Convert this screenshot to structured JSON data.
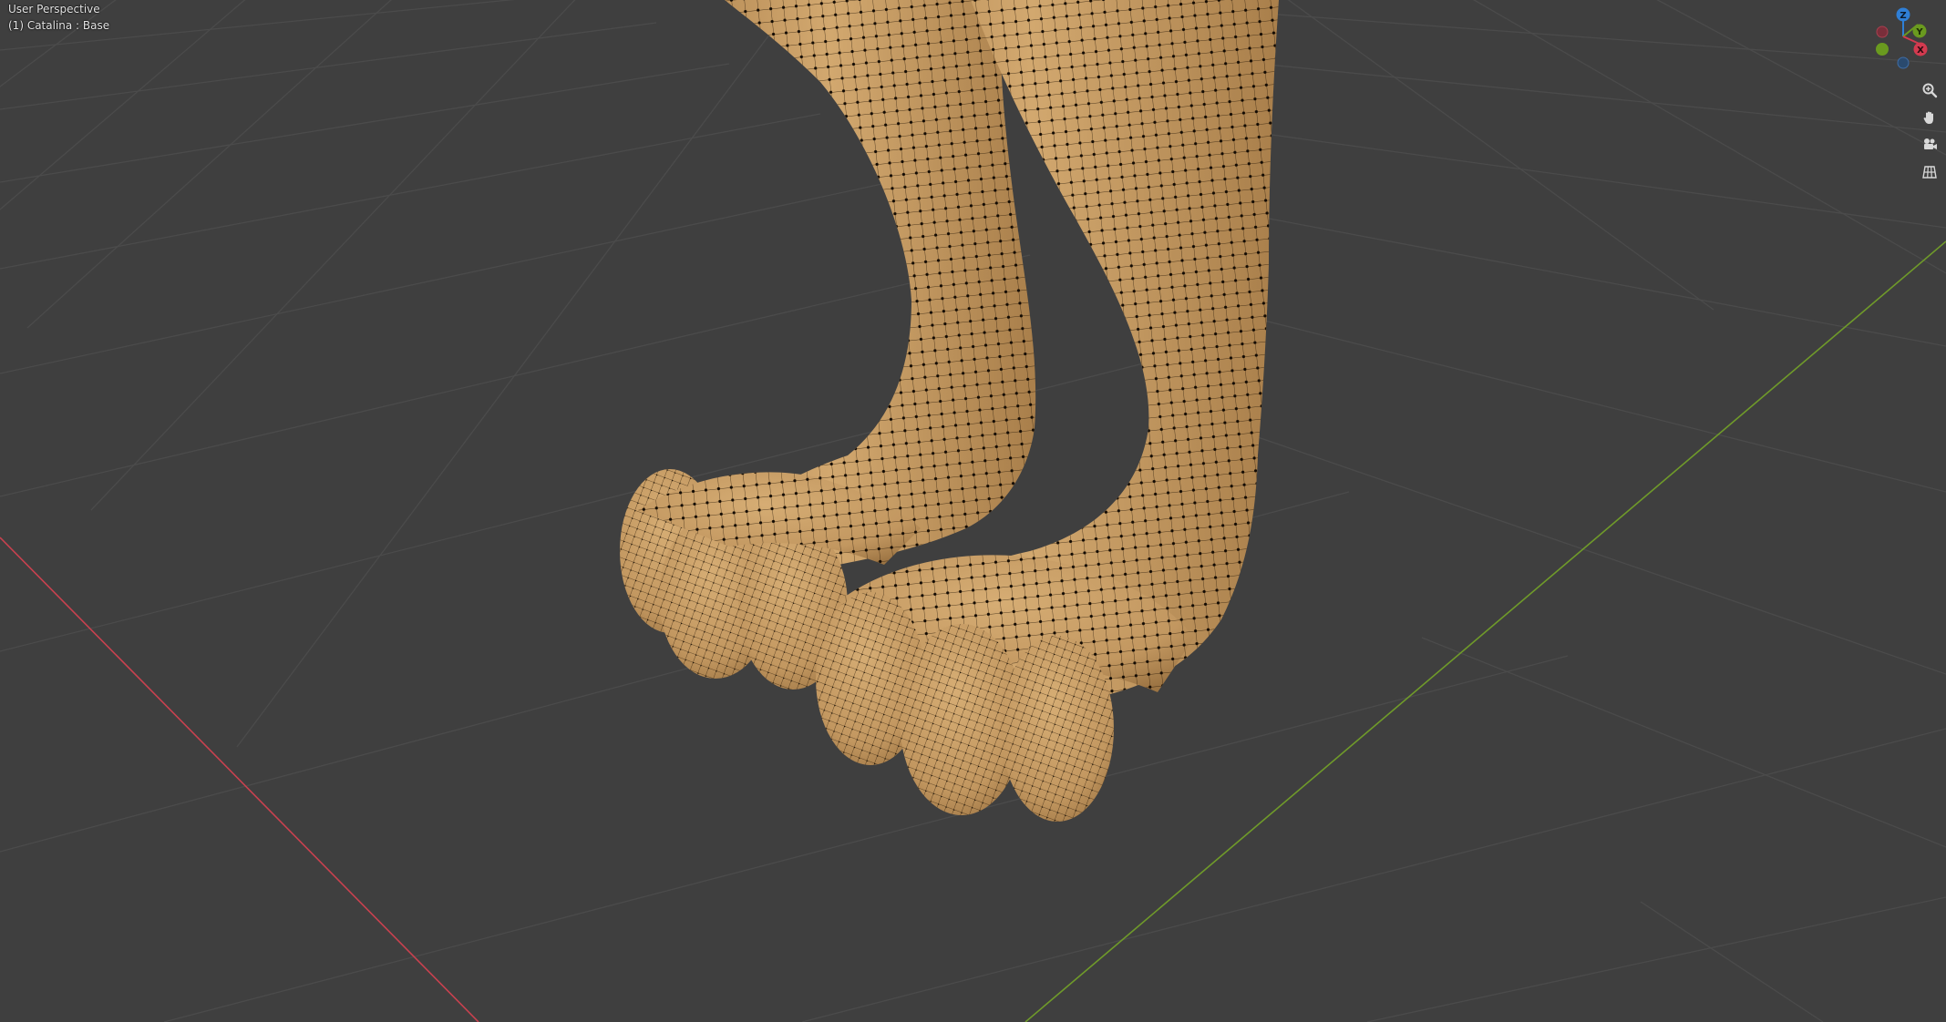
{
  "viewport": {
    "view_name": "User Perspective",
    "object_name": "(1) Catalina : Base"
  },
  "gizmo": {
    "z_label": "Z",
    "y_label": "Y",
    "x_label": "X",
    "colors": {
      "x": "#d33a4f",
      "y": "#6a9a1f",
      "z": "#2f7fd6"
    }
  },
  "nav_buttons": {
    "zoom": "zoom-icon",
    "pan": "hand-icon",
    "camera": "camera-icon",
    "ortho": "grid-icon"
  },
  "colors": {
    "background": "#3f3f3f",
    "grid": "#4a4a4a",
    "x_axis": "#c9414f",
    "y_axis": "#6f9a2a",
    "mesh": "#c39a62",
    "wire": "#1a1208"
  }
}
